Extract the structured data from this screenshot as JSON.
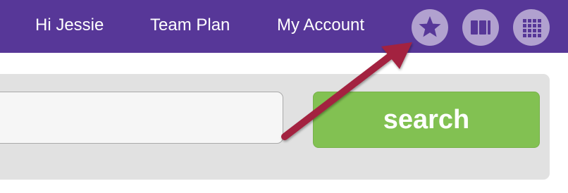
{
  "nav": {
    "greeting": "Hi Jessie",
    "team_plan": "Team Plan",
    "my_account": "My Account",
    "icons": [
      "star-icon",
      "columns-icon",
      "grid-icon"
    ]
  },
  "search": {
    "input_value": "",
    "button_label": "search"
  },
  "colors": {
    "topbar": "#573798",
    "icon_circle": "#b1a1cf",
    "panel": "#e1e1e1",
    "search_button": "#82c152",
    "annotation_arrow": "#a3243f"
  }
}
